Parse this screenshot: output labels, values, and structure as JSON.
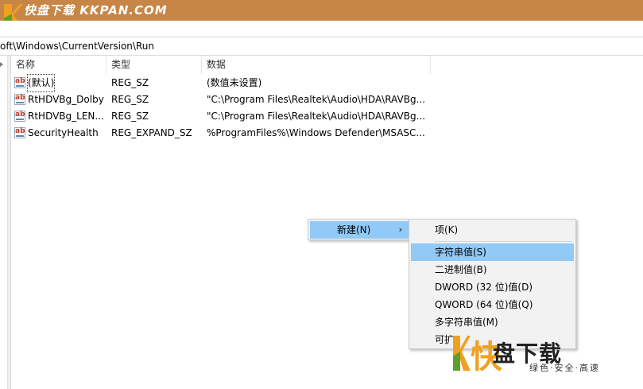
{
  "banner": {
    "brand": "快盘下载 KKPAN.COM"
  },
  "address": {
    "path": "oft\\Windows\\CurrentVersion\\Run"
  },
  "columns": {
    "name": "名称",
    "type": "类型",
    "data": "数据"
  },
  "rows": [
    {
      "name": "(默认)",
      "type": "REG_SZ",
      "data": "(数值未设置)"
    },
    {
      "name": "RtHDVBg_Dolby",
      "type": "REG_SZ",
      "data": "\"C:\\Program Files\\Realtek\\Audio\\HDA\\RAVBg..."
    },
    {
      "name": "RtHDVBg_LEN...",
      "type": "REG_SZ",
      "data": "\"C:\\Program Files\\Realtek\\Audio\\HDA\\RAVBg..."
    },
    {
      "name": "SecurityHealth",
      "type": "REG_EXPAND_SZ",
      "data": "%ProgramFiles%\\Windows Defender\\MSASC..."
    }
  ],
  "context_menu": {
    "new_label": "新建(N)",
    "new_arrow": "›"
  },
  "submenu": {
    "items": [
      {
        "label": "项(K)"
      },
      {
        "label": "字符串值(S)"
      },
      {
        "label": "二进制值(B)"
      },
      {
        "label": "DWORD (32 位)值(D)"
      },
      {
        "label": "QWORD (64 位)值(Q)"
      },
      {
        "label": "多字符串值(M)"
      },
      {
        "label": "可扩"
      }
    ],
    "highlighted_index": 1
  },
  "watermark": {
    "big": "盘下载",
    "kuai": "快",
    "small": "绿色·安全·高速"
  },
  "colors": {
    "banner": "#c78646",
    "highlight": "#91c9f7",
    "logo_orange": "#f0a020",
    "logo_green": "#5aa02c"
  }
}
